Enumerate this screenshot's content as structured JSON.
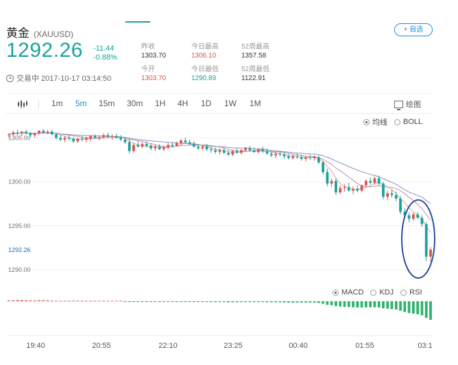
{
  "header": {
    "name": "黄金",
    "symbol": "(XAUUSD)",
    "price": "1292.26",
    "change": "-11.44",
    "change_pct": "-0.88%",
    "status": "交易中 2017-10-17 03:14:50",
    "add_watch_label": "+ 自选"
  },
  "stats": [
    {
      "label": "昨收",
      "value": "1303.70",
      "color": "normal"
    },
    {
      "label": "今日最高",
      "value": "1306.10",
      "color": "red"
    },
    {
      "label": "52周最高",
      "value": "1357.58",
      "color": "normal"
    },
    {
      "label": "今开",
      "value": "1303.70",
      "color": "red"
    },
    {
      "label": "今日最低",
      "value": "1290.89",
      "color": "green"
    },
    {
      "label": "52周最低",
      "value": "1122.91",
      "color": "normal"
    }
  ],
  "toolbar": {
    "periods": [
      "1m",
      "5m",
      "15m",
      "30m",
      "1H",
      "4H",
      "1D",
      "1W",
      "1M"
    ],
    "active_period": "5m",
    "draw_label": "绘图"
  },
  "overlay_options": [
    {
      "label": "均线",
      "selected": true
    },
    {
      "label": "BOLL",
      "selected": false
    }
  ],
  "indicator_options": [
    {
      "label": "MACD",
      "selected": true
    },
    {
      "label": "KDJ",
      "selected": false
    },
    {
      "label": "RSI",
      "selected": false
    }
  ],
  "colors": {
    "up": "#d9534f",
    "down": "#1aa39a",
    "macd_up": "#e87c7c",
    "macd_down": "#2db36d",
    "highlight": "#2d4fa0",
    "accent": "#1a8cd8"
  },
  "chart_data": {
    "type": "candlestick",
    "y_ticks": [
      "1305.00",
      "1300.00",
      "1295.00",
      "1290.00"
    ],
    "current_price_label": "1292.26",
    "x_ticks": [
      "19:40",
      "20:55",
      "22:10",
      "23:25",
      "00:40",
      "01:55",
      "03:1"
    ],
    "ylim": [
      1288.6,
      1306.5
    ],
    "candles": [
      [
        1305.3,
        1305.5,
        1305.0,
        1305.4
      ],
      [
        1305.4,
        1305.8,
        1305.2,
        1305.6
      ],
      [
        1305.6,
        1305.9,
        1305.3,
        1305.5
      ],
      [
        1305.5,
        1305.8,
        1305.2,
        1305.7
      ],
      [
        1305.7,
        1305.9,
        1305.4,
        1305.5
      ],
      [
        1305.5,
        1305.7,
        1305.1,
        1305.3
      ],
      [
        1305.3,
        1305.6,
        1305.0,
        1305.5
      ],
      [
        1305.5,
        1305.9,
        1305.3,
        1305.8
      ],
      [
        1305.8,
        1306.0,
        1305.5,
        1305.6
      ],
      [
        1305.6,
        1305.9,
        1305.4,
        1305.7
      ],
      [
        1305.7,
        1305.9,
        1305.3,
        1305.4
      ],
      [
        1305.4,
        1305.6,
        1304.8,
        1305.0
      ],
      [
        1305.0,
        1305.3,
        1304.6,
        1304.8
      ],
      [
        1304.8,
        1305.2,
        1304.5,
        1305.0
      ],
      [
        1305.0,
        1305.3,
        1304.7,
        1304.9
      ],
      [
        1304.9,
        1305.1,
        1304.4,
        1304.6
      ],
      [
        1304.6,
        1305.0,
        1304.4,
        1304.9
      ],
      [
        1304.9,
        1305.2,
        1304.6,
        1304.8
      ],
      [
        1304.8,
        1305.1,
        1304.5,
        1305.0
      ],
      [
        1304.9,
        1305.3,
        1304.6,
        1305.2
      ],
      [
        1305.2,
        1305.4,
        1304.9,
        1305.0
      ],
      [
        1305.0,
        1305.3,
        1304.7,
        1305.1
      ],
      [
        1305.1,
        1305.5,
        1304.9,
        1305.3
      ],
      [
        1305.3,
        1305.6,
        1305.0,
        1305.1
      ],
      [
        1305.1,
        1305.4,
        1304.8,
        1305.2
      ],
      [
        1305.2,
        1305.5,
        1304.9,
        1305.0
      ],
      [
        1305.0,
        1305.3,
        1304.6,
        1304.8
      ],
      [
        1304.8,
        1305.1,
        1304.3,
        1304.5
      ],
      [
        1304.5,
        1304.9,
        1303.2,
        1303.5
      ],
      [
        1303.5,
        1304.4,
        1303.3,
        1304.2
      ],
      [
        1304.2,
        1304.6,
        1303.9,
        1304.0
      ],
      [
        1304.0,
        1304.5,
        1303.8,
        1304.3
      ],
      [
        1304.3,
        1304.6,
        1303.9,
        1304.1
      ],
      [
        1304.1,
        1304.4,
        1303.6,
        1303.8
      ],
      [
        1303.8,
        1304.2,
        1303.5,
        1304.0
      ],
      [
        1304.0,
        1304.3,
        1303.6,
        1303.7
      ],
      [
        1303.7,
        1304.1,
        1303.5,
        1303.9
      ],
      [
        1303.9,
        1304.4,
        1303.7,
        1304.2
      ],
      [
        1304.2,
        1304.5,
        1303.9,
        1304.1
      ],
      [
        1304.1,
        1304.6,
        1304.0,
        1304.4
      ],
      [
        1304.4,
        1304.9,
        1304.2,
        1304.7
      ],
      [
        1304.7,
        1305.0,
        1304.3,
        1304.5
      ],
      [
        1304.5,
        1304.8,
        1304.2,
        1304.3
      ],
      [
        1304.3,
        1304.6,
        1303.9,
        1304.0
      ],
      [
        1304.0,
        1304.3,
        1303.6,
        1303.8
      ],
      [
        1303.8,
        1304.2,
        1303.6,
        1304.0
      ],
      [
        1304.0,
        1304.3,
        1303.5,
        1303.7
      ],
      [
        1303.7,
        1304.0,
        1303.3,
        1303.6
      ],
      [
        1303.6,
        1303.9,
        1303.2,
        1303.4
      ],
      [
        1303.4,
        1303.8,
        1303.1,
        1303.6
      ],
      [
        1303.6,
        1303.9,
        1303.2,
        1303.3
      ],
      [
        1303.3,
        1303.6,
        1302.9,
        1303.1
      ],
      [
        1303.1,
        1303.6,
        1302.9,
        1303.5
      ],
      [
        1303.5,
        1303.8,
        1303.2,
        1303.3
      ],
      [
        1303.3,
        1303.7,
        1303.1,
        1303.6
      ],
      [
        1303.6,
        1304.0,
        1303.4,
        1303.8
      ],
      [
        1303.8,
        1304.1,
        1303.5,
        1303.6
      ],
      [
        1303.6,
        1303.9,
        1303.3,
        1303.4
      ],
      [
        1303.4,
        1303.8,
        1303.2,
        1303.7
      ],
      [
        1303.7,
        1304.0,
        1303.3,
        1303.5
      ],
      [
        1303.5,
        1303.8,
        1303.1,
        1303.2
      ],
      [
        1303.2,
        1303.5,
        1302.8,
        1303.0
      ],
      [
        1303.0,
        1303.4,
        1302.7,
        1303.2
      ],
      [
        1303.2,
        1303.5,
        1302.9,
        1303.1
      ],
      [
        1303.1,
        1303.4,
        1302.6,
        1302.9
      ],
      [
        1302.9,
        1303.2,
        1302.5,
        1302.7
      ],
      [
        1302.7,
        1303.1,
        1302.5,
        1302.9
      ],
      [
        1302.9,
        1303.2,
        1302.6,
        1302.8
      ],
      [
        1302.8,
        1303.1,
        1302.4,
        1302.6
      ],
      [
        1302.6,
        1302.9,
        1302.3,
        1302.8
      ],
      [
        1302.8,
        1303.1,
        1302.5,
        1302.7
      ],
      [
        1302.7,
        1303.0,
        1302.4,
        1302.9
      ],
      [
        1302.8,
        1303.0,
        1302.0,
        1302.2
      ],
      [
        1302.2,
        1302.4,
        1300.8,
        1301.1
      ],
      [
        1301.1,
        1301.5,
        1299.5,
        1299.8
      ],
      [
        1299.8,
        1300.4,
        1299.4,
        1300.1
      ],
      [
        1300.1,
        1300.4,
        1298.5,
        1298.8
      ],
      [
        1298.8,
        1299.6,
        1298.6,
        1299.3
      ],
      [
        1299.3,
        1299.7,
        1298.9,
        1299.4
      ],
      [
        1299.4,
        1299.9,
        1298.9,
        1299.0
      ],
      [
        1299.0,
        1299.5,
        1298.6,
        1299.2
      ],
      [
        1299.2,
        1299.6,
        1298.8,
        1299.0
      ],
      [
        1299.0,
        1299.7,
        1298.8,
        1299.6
      ],
      [
        1299.6,
        1300.3,
        1299.4,
        1300.1
      ],
      [
        1300.1,
        1300.5,
        1299.7,
        1299.9
      ],
      [
        1299.9,
        1300.6,
        1299.7,
        1300.4
      ],
      [
        1300.4,
        1300.7,
        1299.6,
        1299.8
      ],
      [
        1299.8,
        1300.0,
        1298.0,
        1298.3
      ],
      [
        1298.3,
        1299.0,
        1297.9,
        1298.7
      ],
      [
        1298.7,
        1299.1,
        1298.2,
        1298.5
      ],
      [
        1298.5,
        1298.9,
        1297.8,
        1298.1
      ],
      [
        1298.1,
        1298.4,
        1296.3,
        1296.6
      ],
      [
        1296.6,
        1297.0,
        1296.0,
        1296.2
      ],
      [
        1296.2,
        1296.5,
        1295.4,
        1295.8
      ],
      [
        1295.8,
        1296.5,
        1295.6,
        1296.3
      ],
      [
        1296.3,
        1296.6,
        1295.8,
        1295.9
      ],
      [
        1295.9,
        1296.2,
        1294.9,
        1295.2
      ],
      [
        1295.2,
        1295.4,
        1291.0,
        1291.5
      ],
      [
        1291.5,
        1292.6,
        1290.9,
        1292.3
      ]
    ],
    "macd": [
      0.05,
      0.06,
      0.07,
      0.07,
      0.06,
      0.05,
      0.05,
      0.06,
      0.06,
      0.05,
      0.04,
      0.03,
      0.02,
      0.02,
      0.02,
      0.01,
      0.01,
      0.01,
      0.02,
      0.02,
      0.02,
      0.02,
      0.03,
      0.03,
      0.02,
      0.02,
      0.01,
      -0.01,
      -0.03,
      -0.03,
      -0.03,
      -0.02,
      -0.02,
      -0.03,
      -0.03,
      -0.03,
      -0.03,
      -0.02,
      -0.02,
      -0.02,
      -0.01,
      -0.01,
      -0.02,
      -0.02,
      -0.03,
      -0.03,
      -0.03,
      -0.04,
      -0.04,
      -0.04,
      -0.04,
      -0.05,
      -0.05,
      -0.05,
      -0.04,
      -0.04,
      -0.04,
      -0.04,
      -0.04,
      -0.04,
      -0.05,
      -0.05,
      -0.05,
      -0.05,
      -0.06,
      -0.06,
      -0.06,
      -0.06,
      -0.06,
      -0.06,
      -0.06,
      -0.06,
      -0.08,
      -0.12,
      -0.17,
      -0.19,
      -0.23,
      -0.25,
      -0.27,
      -0.28,
      -0.29,
      -0.3,
      -0.3,
      -0.29,
      -0.29,
      -0.29,
      -0.3,
      -0.34,
      -0.36,
      -0.38,
      -0.4,
      -0.46,
      -0.52,
      -0.57,
      -0.6,
      -0.63,
      -0.68,
      -0.8,
      -0.9
    ]
  }
}
